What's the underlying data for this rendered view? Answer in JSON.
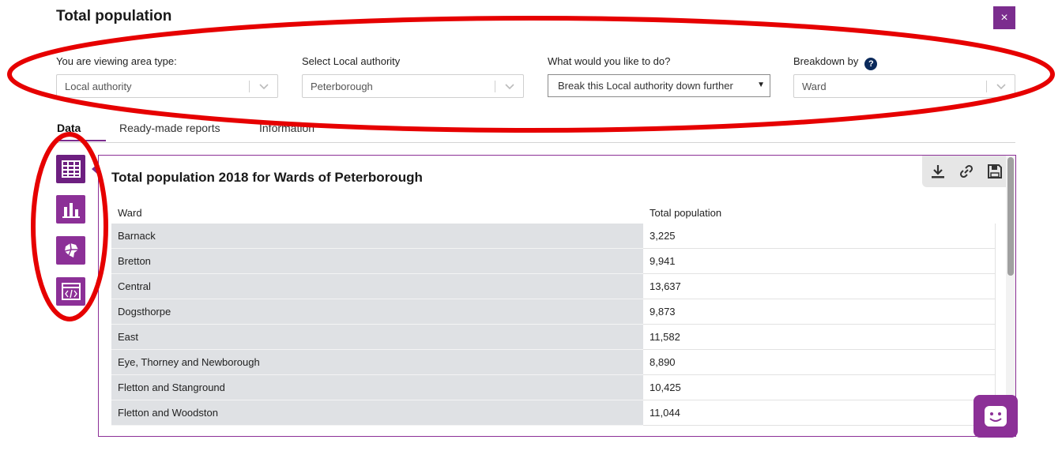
{
  "header": {
    "title": "Total population",
    "close_label": "×"
  },
  "filters": [
    {
      "label": "You are viewing area type:",
      "value": "Local authority"
    },
    {
      "label": "Select Local authority",
      "value": "Peterborough"
    },
    {
      "label": "What would you like to do?",
      "value": "Break this Local authority down further"
    },
    {
      "label": "Breakdown by",
      "value": "Ward",
      "help": "?"
    }
  ],
  "tabs": [
    "Data",
    "Ready-made reports",
    "Information"
  ],
  "side_tools": [
    "table-icon",
    "bar-chart-icon",
    "map-icon",
    "embed-code-icon"
  ],
  "panel": {
    "title": "Total population 2018 for Wards of Peterborough",
    "toolbar": [
      "download-icon",
      "link-icon",
      "save-icon"
    ],
    "columns": [
      "Ward",
      "Total population"
    ],
    "rows": [
      [
        "Barnack",
        "3,225"
      ],
      [
        "Bretton",
        "9,941"
      ],
      [
        "Central",
        "13,637"
      ],
      [
        "Dogsthorpe",
        "9,873"
      ],
      [
        "East",
        "11,582"
      ],
      [
        "Eye, Thorney and Newborough",
        "8,890"
      ],
      [
        "Fletton and Stanground",
        "10,425"
      ],
      [
        "Fletton and Woodston",
        "11,044"
      ]
    ]
  },
  "colors": {
    "accent": "#8c3097",
    "annotation": "#e60000",
    "help": "#0b2a5b"
  }
}
